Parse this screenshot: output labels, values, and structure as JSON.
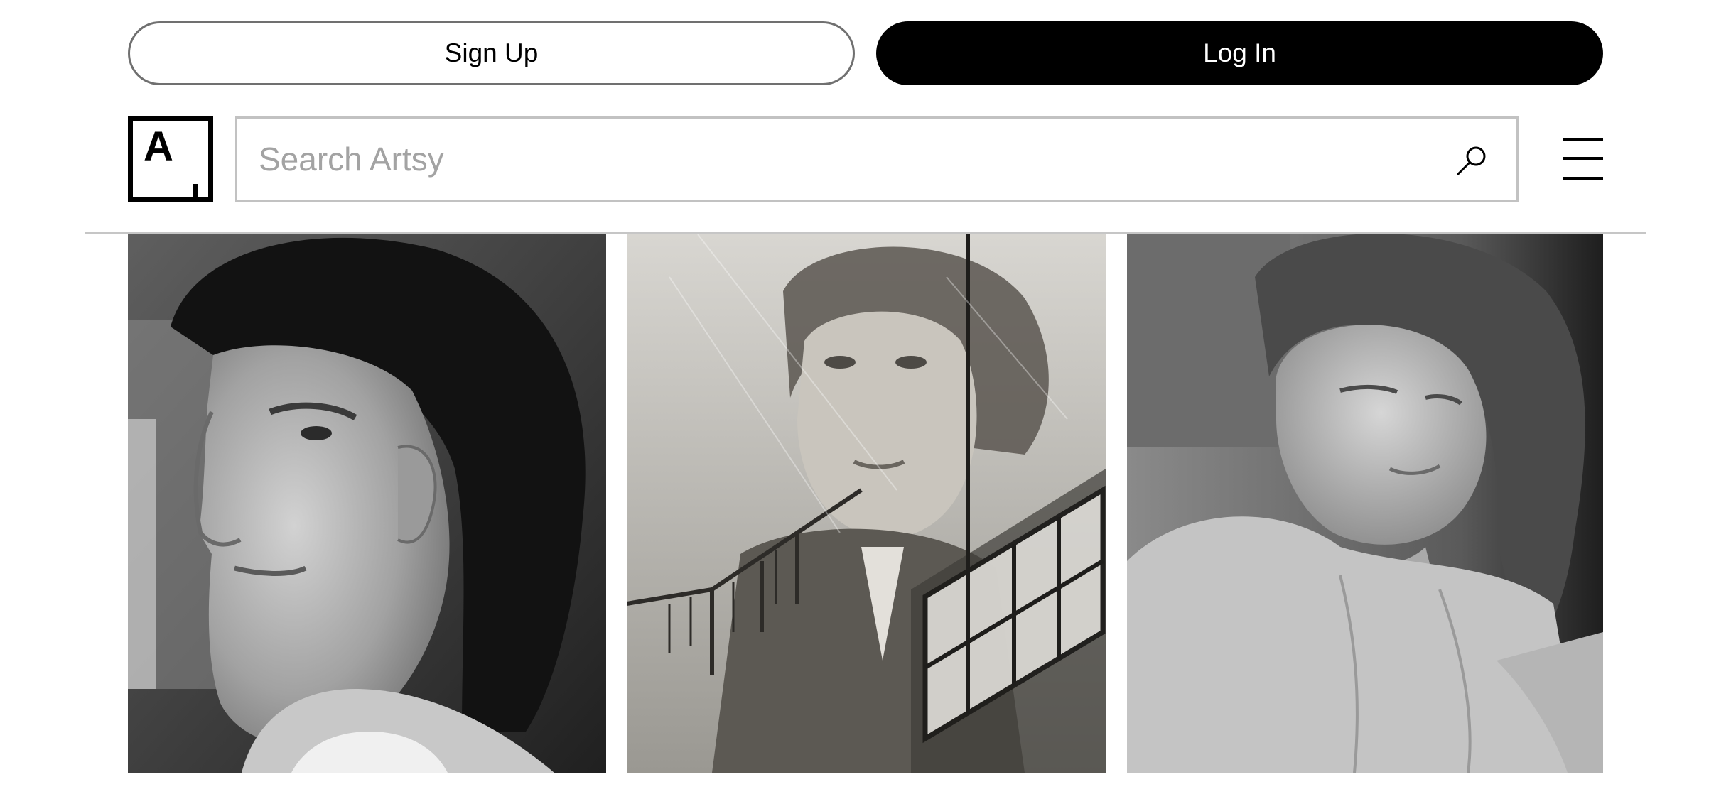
{
  "auth": {
    "signup_label": "Sign Up",
    "login_label": "Log In"
  },
  "header": {
    "logo_letter": "A",
    "search_placeholder": "Search Artsy",
    "search_value": "",
    "search_icon": "search-icon",
    "menu_icon": "hamburger-menu-icon"
  },
  "gallery": {
    "items": [
      {
        "subject": "portrait-photo-1",
        "tone": "black-and-white"
      },
      {
        "subject": "portrait-photo-2",
        "tone": "black-and-white"
      },
      {
        "subject": "portrait-photo-3",
        "tone": "black-and-white"
      }
    ]
  },
  "colors": {
    "primary": "#000000",
    "background": "#ffffff",
    "border": "#c2c2c2",
    "placeholder": "#a3a3a3",
    "divider": "#c6c6c6"
  }
}
